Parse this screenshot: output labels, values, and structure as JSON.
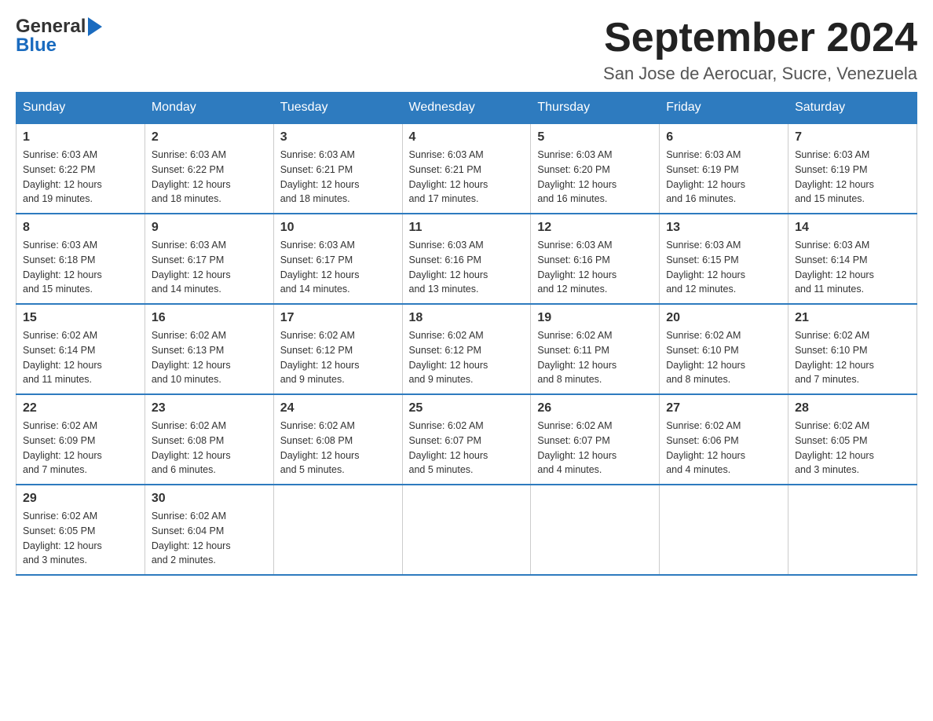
{
  "header": {
    "logo_general": "General",
    "logo_blue": "Blue",
    "month_title": "September 2024",
    "location": "San Jose de Aerocuar, Sucre, Venezuela"
  },
  "days_of_week": [
    "Sunday",
    "Monday",
    "Tuesday",
    "Wednesday",
    "Thursday",
    "Friday",
    "Saturday"
  ],
  "weeks": [
    [
      {
        "day": "1",
        "sunrise": "6:03 AM",
        "sunset": "6:22 PM",
        "daylight": "12 hours and 19 minutes."
      },
      {
        "day": "2",
        "sunrise": "6:03 AM",
        "sunset": "6:22 PM",
        "daylight": "12 hours and 18 minutes."
      },
      {
        "day": "3",
        "sunrise": "6:03 AM",
        "sunset": "6:21 PM",
        "daylight": "12 hours and 18 minutes."
      },
      {
        "day": "4",
        "sunrise": "6:03 AM",
        "sunset": "6:21 PM",
        "daylight": "12 hours and 17 minutes."
      },
      {
        "day": "5",
        "sunrise": "6:03 AM",
        "sunset": "6:20 PM",
        "daylight": "12 hours and 16 minutes."
      },
      {
        "day": "6",
        "sunrise": "6:03 AM",
        "sunset": "6:19 PM",
        "daylight": "12 hours and 16 minutes."
      },
      {
        "day": "7",
        "sunrise": "6:03 AM",
        "sunset": "6:19 PM",
        "daylight": "12 hours and 15 minutes."
      }
    ],
    [
      {
        "day": "8",
        "sunrise": "6:03 AM",
        "sunset": "6:18 PM",
        "daylight": "12 hours and 15 minutes."
      },
      {
        "day": "9",
        "sunrise": "6:03 AM",
        "sunset": "6:17 PM",
        "daylight": "12 hours and 14 minutes."
      },
      {
        "day": "10",
        "sunrise": "6:03 AM",
        "sunset": "6:17 PM",
        "daylight": "12 hours and 14 minutes."
      },
      {
        "day": "11",
        "sunrise": "6:03 AM",
        "sunset": "6:16 PM",
        "daylight": "12 hours and 13 minutes."
      },
      {
        "day": "12",
        "sunrise": "6:03 AM",
        "sunset": "6:16 PM",
        "daylight": "12 hours and 12 minutes."
      },
      {
        "day": "13",
        "sunrise": "6:03 AM",
        "sunset": "6:15 PM",
        "daylight": "12 hours and 12 minutes."
      },
      {
        "day": "14",
        "sunrise": "6:03 AM",
        "sunset": "6:14 PM",
        "daylight": "12 hours and 11 minutes."
      }
    ],
    [
      {
        "day": "15",
        "sunrise": "6:02 AM",
        "sunset": "6:14 PM",
        "daylight": "12 hours and 11 minutes."
      },
      {
        "day": "16",
        "sunrise": "6:02 AM",
        "sunset": "6:13 PM",
        "daylight": "12 hours and 10 minutes."
      },
      {
        "day": "17",
        "sunrise": "6:02 AM",
        "sunset": "6:12 PM",
        "daylight": "12 hours and 9 minutes."
      },
      {
        "day": "18",
        "sunrise": "6:02 AM",
        "sunset": "6:12 PM",
        "daylight": "12 hours and 9 minutes."
      },
      {
        "day": "19",
        "sunrise": "6:02 AM",
        "sunset": "6:11 PM",
        "daylight": "12 hours and 8 minutes."
      },
      {
        "day": "20",
        "sunrise": "6:02 AM",
        "sunset": "6:10 PM",
        "daylight": "12 hours and 8 minutes."
      },
      {
        "day": "21",
        "sunrise": "6:02 AM",
        "sunset": "6:10 PM",
        "daylight": "12 hours and 7 minutes."
      }
    ],
    [
      {
        "day": "22",
        "sunrise": "6:02 AM",
        "sunset": "6:09 PM",
        "daylight": "12 hours and 7 minutes."
      },
      {
        "day": "23",
        "sunrise": "6:02 AM",
        "sunset": "6:08 PM",
        "daylight": "12 hours and 6 minutes."
      },
      {
        "day": "24",
        "sunrise": "6:02 AM",
        "sunset": "6:08 PM",
        "daylight": "12 hours and 5 minutes."
      },
      {
        "day": "25",
        "sunrise": "6:02 AM",
        "sunset": "6:07 PM",
        "daylight": "12 hours and 5 minutes."
      },
      {
        "day": "26",
        "sunrise": "6:02 AM",
        "sunset": "6:07 PM",
        "daylight": "12 hours and 4 minutes."
      },
      {
        "day": "27",
        "sunrise": "6:02 AM",
        "sunset": "6:06 PM",
        "daylight": "12 hours and 4 minutes."
      },
      {
        "day": "28",
        "sunrise": "6:02 AM",
        "sunset": "6:05 PM",
        "daylight": "12 hours and 3 minutes."
      }
    ],
    [
      {
        "day": "29",
        "sunrise": "6:02 AM",
        "sunset": "6:05 PM",
        "daylight": "12 hours and 3 minutes."
      },
      {
        "day": "30",
        "sunrise": "6:02 AM",
        "sunset": "6:04 PM",
        "daylight": "12 hours and 2 minutes."
      },
      null,
      null,
      null,
      null,
      null
    ]
  ],
  "labels": {
    "sunrise": "Sunrise:",
    "sunset": "Sunset:",
    "daylight": "Daylight:"
  }
}
